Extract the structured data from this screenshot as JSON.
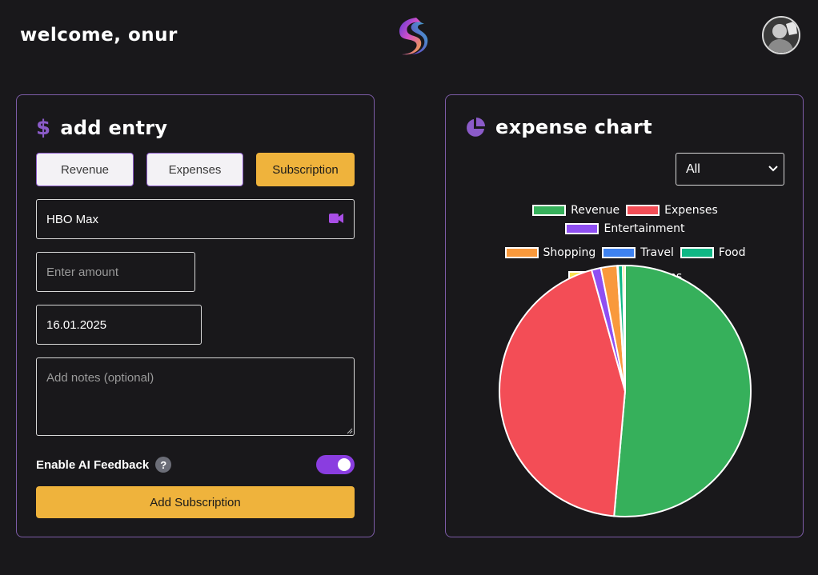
{
  "header": {
    "welcome": "welcome, onur",
    "logo_icon": "app-logo-icon",
    "avatar_icon": "user-avatar"
  },
  "add_entry": {
    "title": "add entry",
    "title_icon": "dollar-icon",
    "tabs": [
      {
        "label": "Revenue",
        "active": false
      },
      {
        "label": "Expenses",
        "active": false
      },
      {
        "label": "Subscription",
        "active": true
      }
    ],
    "service_value": "HBO Max",
    "service_icon": "video-camera-icon",
    "amount_placeholder": "Enter amount",
    "date_value": "16.01.2025",
    "notes_placeholder": "Add notes (optional)",
    "ai_feedback_label": "Enable AI Feedback",
    "ai_help": "?",
    "ai_feedback_enabled": true,
    "submit_label": "Add Subscription"
  },
  "expense_chart": {
    "title": "expense chart",
    "title_icon": "pie-chart-icon",
    "filter_selected": "All"
  },
  "chart_data": {
    "type": "pie",
    "title": "",
    "legend_position": "top",
    "categories": [
      "Revenue",
      "Expenses",
      "Entertainment",
      "Shopping",
      "Travel",
      "Food",
      "Subscriptions"
    ],
    "values": [
      51.4,
      44.3,
      1.2,
      2.1,
      0.1,
      0.6,
      0.3
    ],
    "colors": [
      "#36b05b",
      "#f34d56",
      "#8f4ff2",
      "#f9993c",
      "#3e82f0",
      "#10b785",
      "#f8e24f"
    ]
  },
  "theme": {
    "accent": "#efb33c",
    "purple": "#8a3de0",
    "border": "#7d5ca8",
    "background": "#19181b"
  }
}
